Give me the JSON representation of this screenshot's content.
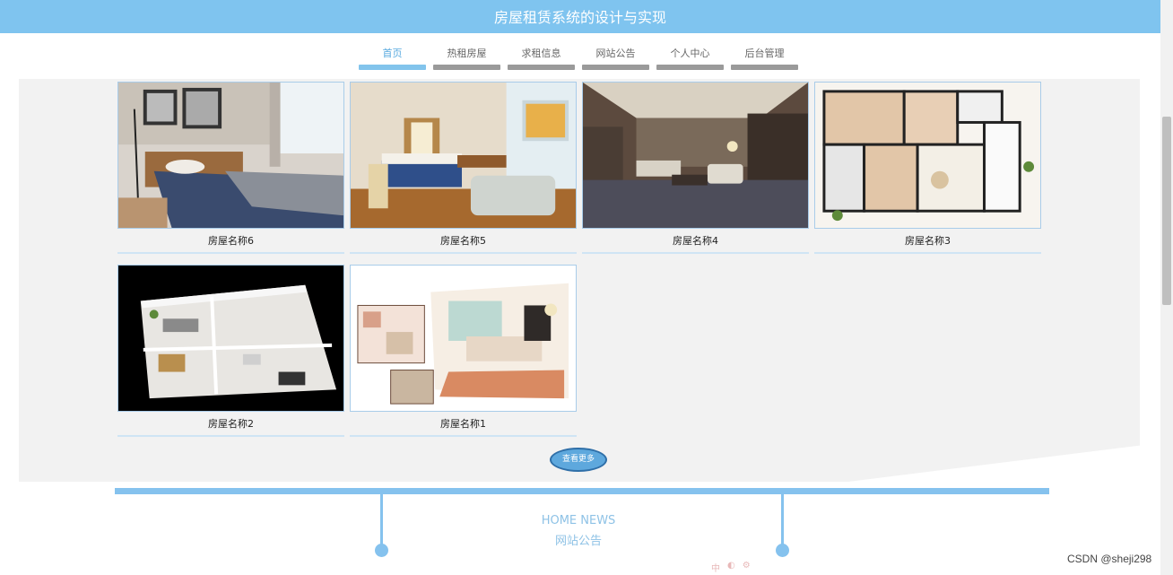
{
  "header": {
    "title": "房屋租赁系统的设计与实现"
  },
  "nav": {
    "items": [
      {
        "label": "首页",
        "active": true
      },
      {
        "label": "热租房屋",
        "active": false
      },
      {
        "label": "求租信息",
        "active": false
      },
      {
        "label": "网站公告",
        "active": false
      },
      {
        "label": "个人中心",
        "active": false
      },
      {
        "label": "后台管理",
        "active": false
      }
    ]
  },
  "houses": [
    {
      "name": "房屋名称6",
      "image": "bedroom-photo"
    },
    {
      "name": "房屋名称5",
      "image": "hotel-room-photo"
    },
    {
      "name": "房屋名称4",
      "image": "living-room-photo"
    },
    {
      "name": "房屋名称3",
      "image": "floor-plan"
    },
    {
      "name": "房屋名称2",
      "image": "3d-floor-plan"
    },
    {
      "name": "房屋名称1",
      "image": "interior-sketch"
    }
  ],
  "more_button": {
    "label": "查看更多"
  },
  "news": {
    "title_en": "HOME NEWS",
    "title_zh": "网站公告"
  },
  "ime_bar": {
    "glyph": "中"
  },
  "watermark": "CSDN @sheji298",
  "colors": {
    "accent": "#7fc4ef",
    "panel": "#f2f2f2",
    "nav_inactive": "#9a9a9a"
  }
}
